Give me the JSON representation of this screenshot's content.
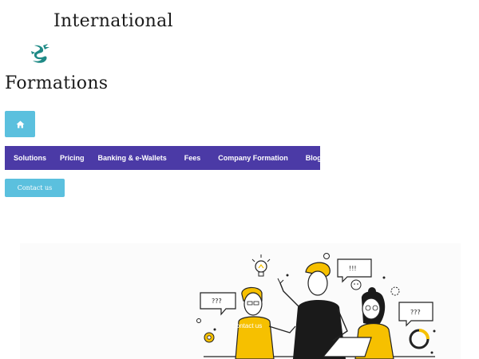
{
  "brand": {
    "line1": "International",
    "line2": "Formations",
    "logo_icon": "dragon-logo-icon",
    "logo_color": "#1f8a86"
  },
  "home_button": {
    "icon": "home-icon",
    "color": "#5bc0de"
  },
  "nav": {
    "background": "#4b3aa6",
    "items": [
      {
        "label": "Solutions"
      },
      {
        "label": "Pricing"
      },
      {
        "label": "Banking & e-Wallets"
      },
      {
        "label": "Fees"
      },
      {
        "label": "Company Formation"
      },
      {
        "label": "Blog"
      }
    ]
  },
  "contact_button": {
    "label": "Contact us",
    "color": "#5bc0de"
  },
  "hero": {
    "bubble_left": "???",
    "bubble_top": "!!!",
    "bubble_right": "???",
    "caption": "Contact us",
    "accent": "#f6c000"
  }
}
